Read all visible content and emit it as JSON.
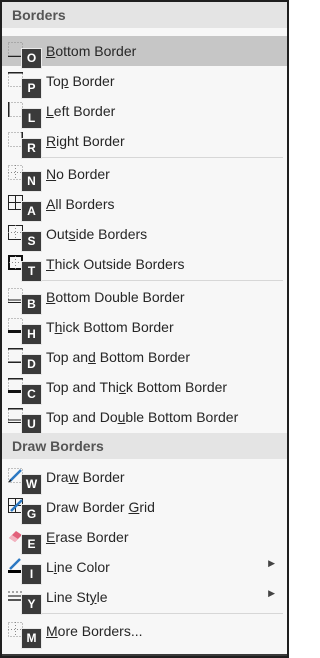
{
  "sections": {
    "borders": "Borders",
    "draw_borders": "Draw Borders"
  },
  "items": [
    {
      "pre": "",
      "u": "B",
      "post": "ottom Border",
      "key": "O",
      "icon": "bottom-border-icon"
    },
    {
      "pre": "To",
      "u": "p",
      "post": " Border",
      "key": "P",
      "icon": "top-border-icon"
    },
    {
      "pre": "",
      "u": "L",
      "post": "eft Border",
      "key": "L",
      "icon": "left-border-icon"
    },
    {
      "pre": "",
      "u": "R",
      "post": "ight Border",
      "key": "R",
      "icon": "right-border-icon"
    },
    {
      "pre": "",
      "u": "N",
      "post": "o Border",
      "key": "N",
      "icon": "no-border-icon"
    },
    {
      "pre": "",
      "u": "A",
      "post": "ll Borders",
      "key": "A",
      "icon": "all-borders-icon"
    },
    {
      "pre": "Out",
      "u": "s",
      "post": "ide Borders",
      "key": "S",
      "icon": "outside-borders-icon"
    },
    {
      "pre": "",
      "u": "T",
      "post": "hick Outside Borders",
      "key": "T",
      "icon": "thick-outside-borders-icon"
    },
    {
      "pre": "",
      "u": "B",
      "post": "ottom Double Border",
      "key": "B",
      "icon": "bottom-double-border-icon"
    },
    {
      "pre": "T",
      "u": "h",
      "post": "ick Bottom Border",
      "key": "H",
      "icon": "thick-bottom-border-icon"
    },
    {
      "pre": "Top an",
      "u": "d",
      "post": " Bottom Border",
      "key": "D",
      "icon": "top-and-bottom-border-icon"
    },
    {
      "pre": "Top and Thi",
      "u": "c",
      "post": "k Bottom Border",
      "key": "C",
      "icon": "top-and-thick-bottom-border-icon"
    },
    {
      "pre": "Top and Do",
      "u": "u",
      "post": "ble Bottom Border",
      "key": "U",
      "icon": "top-and-double-bottom-border-icon"
    },
    {
      "pre": "Dra",
      "u": "w",
      "post": " Border",
      "key": "W",
      "icon": "draw-border-icon"
    },
    {
      "pre": "Draw Border ",
      "u": "G",
      "post": "rid",
      "key": "G",
      "icon": "draw-border-grid-icon"
    },
    {
      "pre": "",
      "u": "E",
      "post": "rase Border",
      "key": "E",
      "icon": "eraser-icon"
    },
    {
      "pre": "L",
      "u": "i",
      "post": "ne Color",
      "key": "I",
      "icon": "line-color-icon"
    },
    {
      "pre": "Line St",
      "u": "y",
      "post": "le",
      "key": "Y",
      "icon": "line-style-icon"
    },
    {
      "pre": "",
      "u": "M",
      "post": "ore Borders...",
      "key": "M",
      "icon": "more-borders-icon"
    }
  ],
  "colors": {
    "highlight": "#c6c6c6",
    "section_bg": "#e4e4e4",
    "pen_blue": "#2b78c2",
    "eraser_pink": "#e2607a",
    "line_color_black": "#000000"
  }
}
